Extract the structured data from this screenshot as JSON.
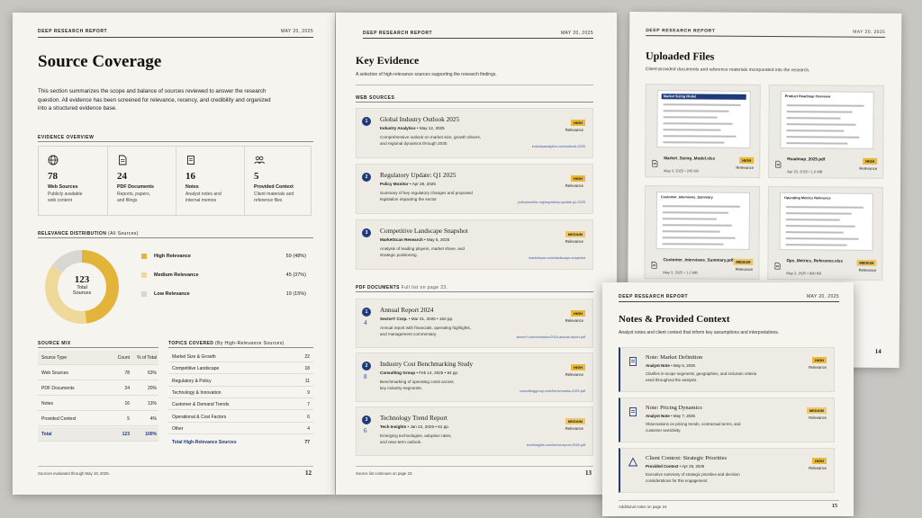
{
  "p12": {
    "header": "DEEP RESEARCH REPORT",
    "date": "MAY 20, 2025",
    "title": "Source Coverage",
    "intro": "This section summarizes the scope and balance of sources reviewed to answer the research question. All evidence has been screened for relevance, recency, and credibility and organized into a structured evidence base.",
    "overview_title": "EVIDENCE OVERVIEW",
    "overview": [
      {
        "icon": "globe-icon",
        "num": "78",
        "label": "Web Sources",
        "desc1": "Publicly available",
        "desc2": "web content"
      },
      {
        "icon": "document-icon",
        "num": "24",
        "label": "PDF Documents",
        "desc1": "Reports, papers,",
        "desc2": "and filings"
      },
      {
        "icon": "notes-icon",
        "num": "16",
        "label": "Notes",
        "desc1": "Analyst notes and",
        "desc2": "internal memos"
      },
      {
        "icon": "people-icon",
        "num": "5",
        "label": "Provided Context",
        "desc1": "Client materials and",
        "desc2": "reference files"
      }
    ],
    "relevance_title": "RELEVANCE DISTRIBUTION",
    "relevance_sub": "(All Sources)",
    "donut_num": "123",
    "donut_l1": "Total",
    "donut_l2": "Sources",
    "relevance": [
      {
        "label": "High Relevance",
        "value": "59 (48%)",
        "color": "#e3b43a",
        "frac": 0.48
      },
      {
        "label": "Medium Relevance",
        "value": "45 (37%)",
        "color": "#efd99a",
        "frac": 0.37
      },
      {
        "label": "Low Relevance",
        "value": "19 (15%)",
        "color": "#d9d7d2",
        "frac": 0.15
      }
    ],
    "mix_title": "SOURCE MIX",
    "mix_head": [
      "Source Type",
      "Count",
      "% of Total"
    ],
    "mix_rows": [
      [
        "Web Sources",
        "78",
        "63%"
      ],
      [
        "PDF Documents",
        "24",
        "20%"
      ],
      [
        "Notes",
        "16",
        "13%"
      ],
      [
        "Provided Context",
        "5",
        "4%"
      ]
    ],
    "mix_total": [
      "Total",
      "123",
      "100%"
    ],
    "topics_title": "TOPICS COVERED",
    "topics_sub": "(By High-Relevance Sources)",
    "topics": [
      [
        "Market Size & Growth",
        "22"
      ],
      [
        "Competitive Landscape",
        "18"
      ],
      [
        "Regulatory & Policy",
        "11"
      ],
      [
        "Technology & Innovation",
        "9"
      ],
      [
        "Customer & Demand Trends",
        "7"
      ],
      [
        "Operational & Cost Factors",
        "6"
      ],
      [
        "Other",
        "4"
      ]
    ],
    "topics_total": [
      "Total High-Relevance Sources",
      "77"
    ],
    "footer": "Sources evaluated through May 18, 2025.",
    "page": "12"
  },
  "p13": {
    "header": "DEEP RESEARCH REPORT",
    "date": "MAY 20, 2025",
    "title": "Key Evidence",
    "intro": "A selection of high-relevance sources supporting the research findings.",
    "web_title": "WEB SOURCES",
    "web": [
      {
        "n": "1",
        "title": "Global Industry Outlook 2025",
        "src": "Industry Analytics",
        "date": "May 12, 2025",
        "desc1": "Comprehensive outlook on market size, growth drivers,",
        "desc2": "and regional dynamics through 2030.",
        "badge": "HIGH",
        "rel": "Relevance",
        "url": "industryanalytics.com/outlook-2025"
      },
      {
        "n": "2",
        "title": "Regulatory Update: Q1 2025",
        "src": "Policy Monitor",
        "date": "Apr 28, 2025",
        "desc1": "Summary of key regulatory changes and proposed",
        "desc2": "legislation impacting the sector.",
        "badge": "HIGH",
        "rel": "Relevance",
        "url": "policymonitor.org/regulatory-update-q1-2025"
      },
      {
        "n": "3",
        "title": "Competitive Landscape Snapshot",
        "src": "MarketScan Research",
        "date": "May 5, 2025",
        "desc1": "Analysis of leading players, market share, and",
        "desc2": "strategic positioning.",
        "badge": "MEDIUM",
        "rel": "Relevance",
        "url": "marketscan.com/landscape-snapshot"
      }
    ],
    "pdf_title": "PDF DOCUMENTS",
    "pdf_sub": "Full list on page 23.",
    "pdf": [
      {
        "n": "1",
        "pg": "4",
        "title": "Annual Report 2024",
        "src": "SectorY Corp.",
        "date": "Mar 31, 2025",
        "pages": "162 pp.",
        "desc1": "Annual report with financials, operating highlights,",
        "desc2": "and management commentary.",
        "badge": "HIGH",
        "rel": "Relevance",
        "url": "sectorY.com/investors/2024-annual-report.pdf"
      },
      {
        "n": "2",
        "pg": "8",
        "title": "Industry Cost Benchmarking Study",
        "src": "Consulting Group",
        "date": "Feb 14, 2025",
        "pages": "84 pp.",
        "desc1": "Benchmarking of operating costs across",
        "desc2": "key industry segments.",
        "badge": "HIGH",
        "rel": "Relevance",
        "url": "consultinggroup.com/benchmarks-2025.pdf"
      },
      {
        "n": "3",
        "pg": "6",
        "title": "Technology Trend Report",
        "src": "Tech Insights",
        "date": "Jan 22, 2025",
        "pages": "61 pp.",
        "desc1": "Emerging technologies, adoption rates,",
        "desc2": "and near-term outlook.",
        "badge": "MEDIUM",
        "rel": "Relevance",
        "url": "techinsights.com/trend-report-2025.pdf"
      }
    ],
    "footer": "Source list continues on page 23.",
    "page": "13"
  },
  "p14": {
    "header": "DEEP RESEARCH REPORT",
    "date": "MAY 20, 2025",
    "title": "Uploaded Files",
    "intro": "Client-provided documents and reference materials incorporated into the research.",
    "files": [
      {
        "thumb": "Market Sizing Model",
        "name": "Market_Sizing_Model.xlsx",
        "meta": "May 3, 2025  •  245 KB",
        "badge": "HIGH",
        "rel": "Relevance"
      },
      {
        "thumb": "Product Roadmap Overview",
        "name": "Roadmap_2025.pdf",
        "meta": "Apr 20, 2025  •  1.6 MB",
        "badge": "HIGH",
        "rel": "Relevance"
      },
      {
        "thumb": "Customer_Interviews_Summary",
        "name": "Customer_Interviews_Summary.pdf",
        "meta": "May 3, 2025  •  1.2 MB",
        "badge": "MEDIUM",
        "rel": "Relevance"
      },
      {
        "thumb": "Operating Metrics Reference",
        "name": "Ops_Metrics_Reference.xlsx",
        "meta": "May 3, 2025  •  890 KB",
        "badge": "MEDIUM",
        "rel": "Relevance"
      }
    ],
    "page": "14"
  },
  "p15": {
    "header": "DEEP RESEARCH REPORT",
    "date": "MAY 20, 2025",
    "title": "Notes & Provided Context",
    "intro": "Analyst notes and client context that inform key assumptions and interpretations.",
    "notes": [
      {
        "icon": "note-icon",
        "title": "Note: Market Definition",
        "src": "Analyst Note",
        "date": "May 6, 2025",
        "desc1": "Clarifies in-scope segments, geographies, and inclusion criteria",
        "desc2": "used throughout the analysis.",
        "badge": "HIGH",
        "rel": "Relevance"
      },
      {
        "icon": "note-icon",
        "title": "Note: Pricing Dynamics",
        "src": "Analyst Note",
        "date": "May 7, 2025",
        "desc1": "Observations on pricing trends, contractual terms, and",
        "desc2": "customer sensitivity.",
        "badge": "MEDIUM",
        "rel": "Relevance"
      },
      {
        "icon": "context-icon",
        "title": "Client Context: Strategic Priorities",
        "src": "Provided Context",
        "date": "Apr 29, 2025",
        "desc1": "Executive summary of strategic priorities and decision",
        "desc2": "considerations for this engagement.",
        "badge": "HIGH",
        "rel": "Relevance"
      }
    ],
    "footer": "Additional notes on page 24.",
    "page": "15"
  }
}
